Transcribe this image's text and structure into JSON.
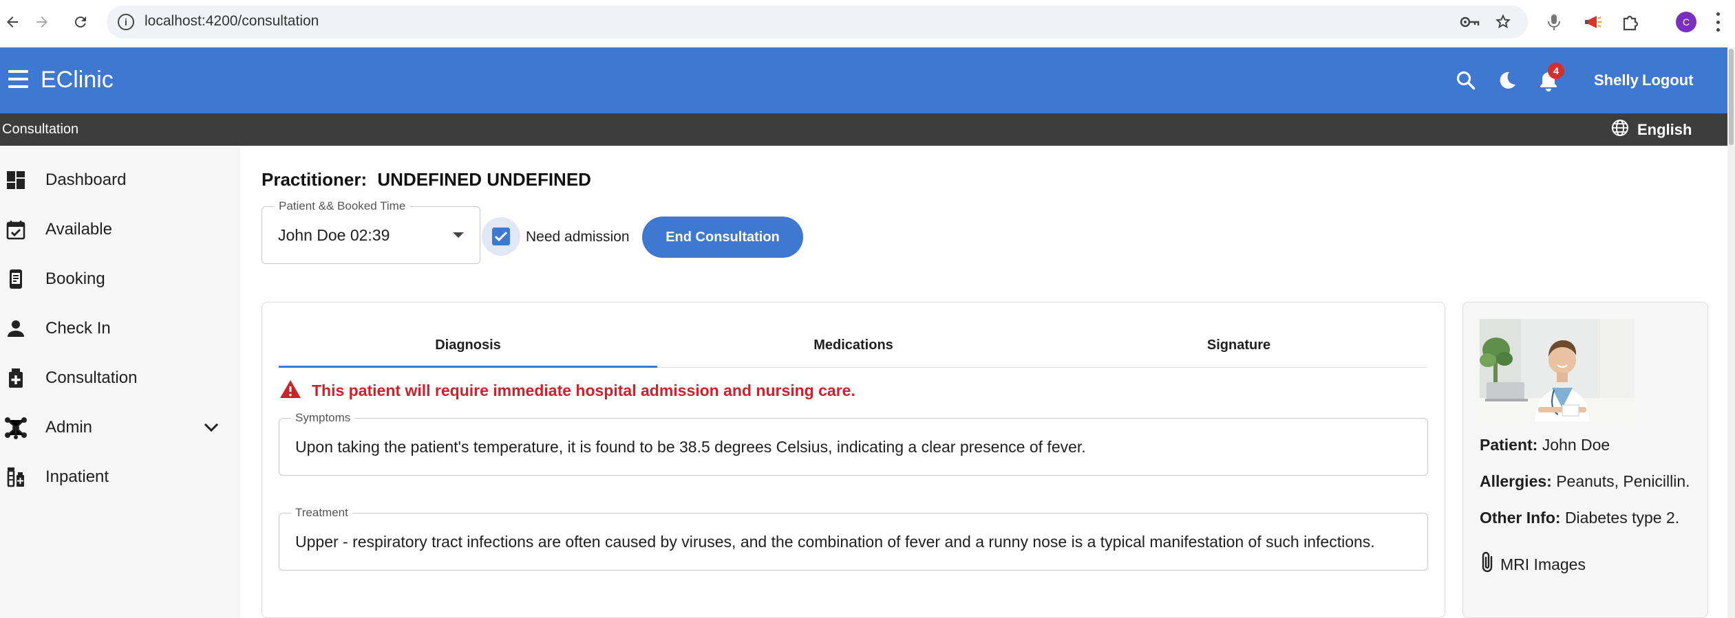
{
  "browser": {
    "url": "localhost:4200/consultation",
    "profile_initial": "C"
  },
  "app": {
    "title": "EClinic",
    "notification_count": "4",
    "user_name": "Shelly",
    "logout_label": "Logout",
    "page_title": "Consultation",
    "language": "English"
  },
  "sidebar": {
    "items": [
      {
        "label": "Dashboard",
        "icon": "dashboard-icon"
      },
      {
        "label": "Available",
        "icon": "calendar-check-icon"
      },
      {
        "label": "Booking",
        "icon": "booking-phone-icon"
      },
      {
        "label": "Check In",
        "icon": "person-icon"
      },
      {
        "label": "Consultation",
        "icon": "medical-kit-icon"
      },
      {
        "label": "Admin",
        "icon": "hub-icon"
      },
      {
        "label": "Inpatient",
        "icon": "vaccine-icon"
      }
    ]
  },
  "consultation": {
    "practitioner_label": "Practitioner:",
    "practitioner_name": "UNDEFINED UNDEFINED",
    "patient_select_label": "Patient && Booked Time",
    "patient_select_value": "John Doe 02:39",
    "need_admission_label": "Need admission",
    "need_admission_checked": true,
    "end_button": "End Consultation",
    "tabs": [
      "Diagnosis",
      "Medications",
      "Signature"
    ],
    "active_tab": "Diagnosis",
    "alert": "This patient will require immediate hospital admission and nursing care.",
    "symptoms_label": "Symptoms",
    "symptoms_value": "Upon taking the patient's temperature, it is found to be 38.5 degrees Celsius, indicating a clear presence of fever.",
    "treatment_label": "Treatment",
    "treatment_value": "Upper - respiratory tract infections are often caused by viruses, and the combination of fever and a runny nose is a typical manifestation of such infections."
  },
  "patient_card": {
    "patient_label": "Patient:",
    "patient_value": "John Doe",
    "allergies_label": "Allergies:",
    "allergies_value": "Peanuts, Penicillin.",
    "other_label": "Other Info:",
    "other_value": "Diabetes type 2.",
    "mri_label": "MRI Images"
  },
  "colors": {
    "primary": "#3f78d0",
    "subbar": "#3d3d3d",
    "alert": "#cc2229",
    "sidebar_bg": "#f6f6f6"
  }
}
